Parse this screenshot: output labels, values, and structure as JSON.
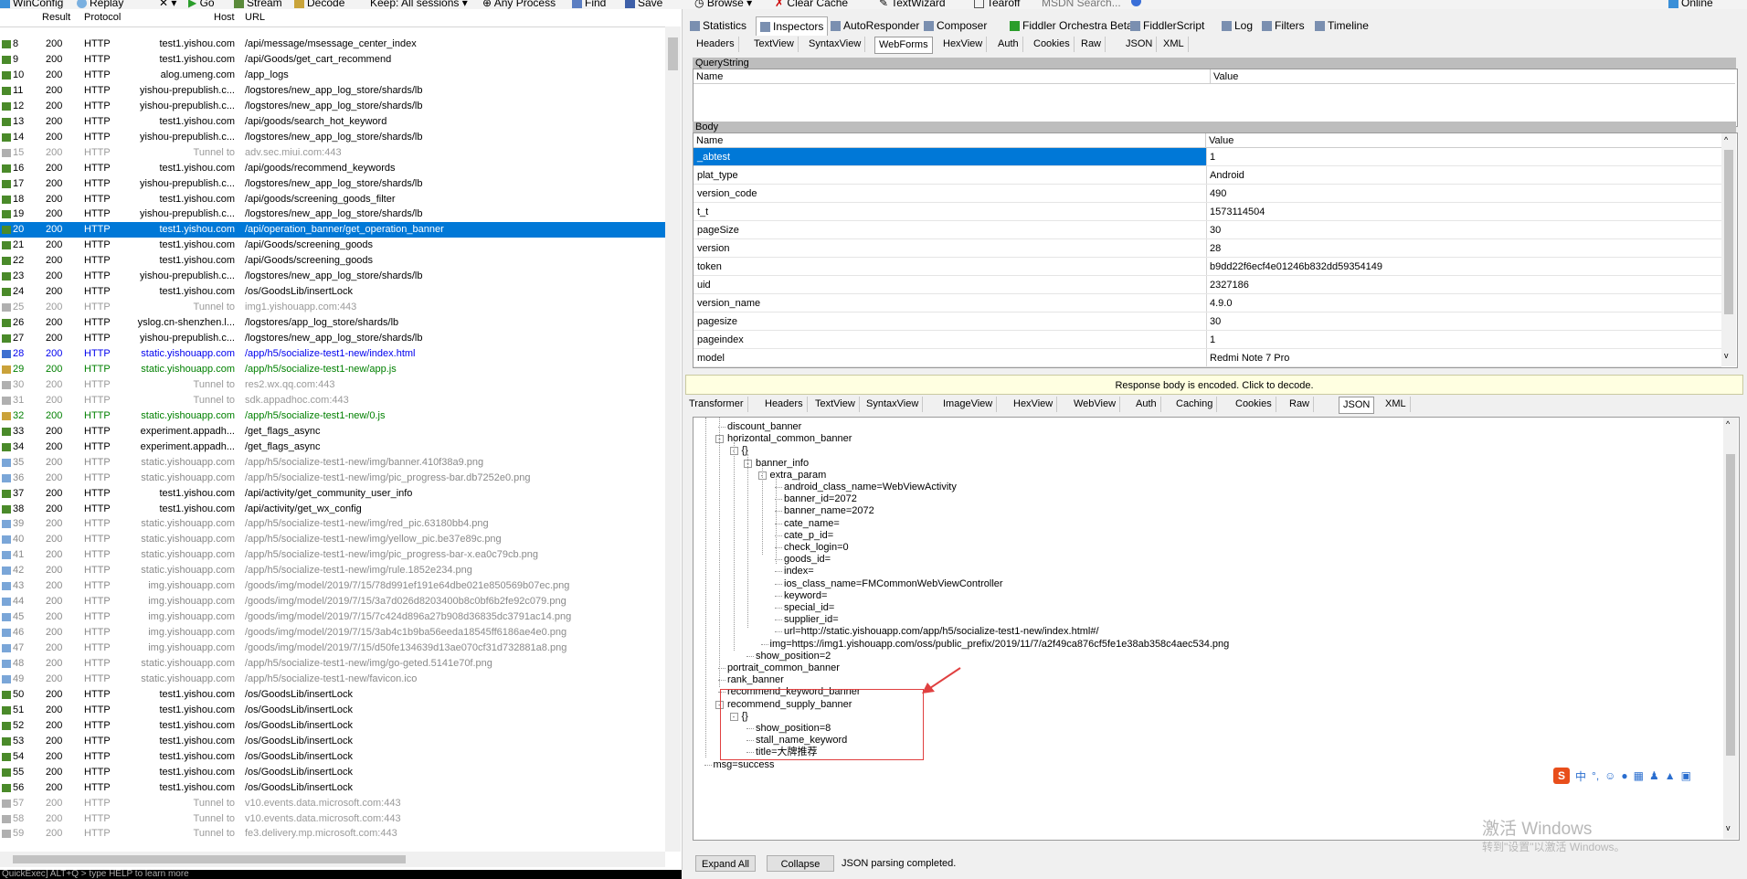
{
  "toolbar": {
    "winconfig": "WinConfig",
    "replay": "Replay",
    "remove": "✕ ▾",
    "go": "Go",
    "stream": "Stream",
    "decode": "Decode",
    "keep": "Keep: All sessions ▾",
    "process": "Any Process",
    "find": "Find",
    "save": "Save",
    "browse": "Browse ▾",
    "clear_cache": "Clear Cache",
    "textwizard": "TextWizard",
    "tearoff": "Tearoff",
    "msdn": "MSDN Search...",
    "online": "Online"
  },
  "sessions": {
    "headers": {
      "result": "Result",
      "protocol": "Protocol",
      "host": "Host",
      "url": "URL"
    },
    "rows": [
      {
        "num": "8",
        "result": "200",
        "protocol": "HTTP",
        "host": "test1.yishou.com",
        "url": "/api/message/msessage_center_index",
        "style": "normal",
        "icon": "arrow"
      },
      {
        "num": "9",
        "result": "200",
        "protocol": "HTTP",
        "host": "test1.yishou.com",
        "url": "/api/Goods/get_cart_recommend",
        "style": "normal",
        "icon": "arrow"
      },
      {
        "num": "10",
        "result": "200",
        "protocol": "HTTP",
        "host": "alog.umeng.com",
        "url": "/app_logs",
        "style": "normal",
        "icon": "arrow"
      },
      {
        "num": "11",
        "result": "200",
        "protocol": "HTTP",
        "host": "yishou-prepublish.c...",
        "url": "/logstores/new_app_log_store/shards/lb",
        "style": "normal",
        "icon": "arrow"
      },
      {
        "num": "12",
        "result": "200",
        "protocol": "HTTP",
        "host": "yishou-prepublish.c...",
        "url": "/logstores/new_app_log_store/shards/lb",
        "style": "normal",
        "icon": "arrow"
      },
      {
        "num": "13",
        "result": "200",
        "protocol": "HTTP",
        "host": "test1.yishou.com",
        "url": "/api/goods/search_hot_keyword",
        "style": "normal",
        "icon": "arrow"
      },
      {
        "num": "14",
        "result": "200",
        "protocol": "HTTP",
        "host": "yishou-prepublish.c...",
        "url": "/logstores/new_app_log_store/shards/lb",
        "style": "normal",
        "icon": "arrow"
      },
      {
        "num": "15",
        "result": "200",
        "protocol": "HTTP",
        "host": "Tunnel to",
        "url": "adv.sec.miui.com:443",
        "style": "tun",
        "icon": "lock"
      },
      {
        "num": "16",
        "result": "200",
        "protocol": "HTTP",
        "host": "test1.yishou.com",
        "url": "/api/goods/recommend_keywords",
        "style": "normal",
        "icon": "arrow"
      },
      {
        "num": "17",
        "result": "200",
        "protocol": "HTTP",
        "host": "yishou-prepublish.c...",
        "url": "/logstores/new_app_log_store/shards/lb",
        "style": "normal",
        "icon": "arrow"
      },
      {
        "num": "18",
        "result": "200",
        "protocol": "HTTP",
        "host": "test1.yishou.com",
        "url": "/api/goods/screening_goods_filter",
        "style": "normal",
        "icon": "arrow"
      },
      {
        "num": "19",
        "result": "200",
        "protocol": "HTTP",
        "host": "yishou-prepublish.c...",
        "url": "/logstores/new_app_log_store/shards/lb",
        "style": "normal",
        "icon": "arrow"
      },
      {
        "num": "20",
        "result": "200",
        "protocol": "HTTP",
        "host": "test1.yishou.com",
        "url": "/api/operation_banner/get_operation_banner",
        "style": "sel",
        "icon": "arrow"
      },
      {
        "num": "21",
        "result": "200",
        "protocol": "HTTP",
        "host": "test1.yishou.com",
        "url": "/api/Goods/screening_goods",
        "style": "normal",
        "icon": "arrow"
      },
      {
        "num": "22",
        "result": "200",
        "protocol": "HTTP",
        "host": "test1.yishou.com",
        "url": "/api/Goods/screening_goods",
        "style": "normal",
        "icon": "arrow"
      },
      {
        "num": "23",
        "result": "200",
        "protocol": "HTTP",
        "host": "yishou-prepublish.c...",
        "url": "/logstores/new_app_log_store/shards/lb",
        "style": "normal",
        "icon": "arrow"
      },
      {
        "num": "24",
        "result": "200",
        "protocol": "HTTP",
        "host": "test1.yishou.com",
        "url": "/os/GoodsLib/insertLock",
        "style": "normal",
        "icon": "arrow"
      },
      {
        "num": "25",
        "result": "200",
        "protocol": "HTTP",
        "host": "Tunnel to",
        "url": "img1.yishouapp.com:443",
        "style": "tun",
        "icon": "lock"
      },
      {
        "num": "26",
        "result": "200",
        "protocol": "HTTP",
        "host": "yslog.cn-shenzhen.l...",
        "url": "/logstores/app_log_store/shards/lb",
        "style": "normal",
        "icon": "arrow"
      },
      {
        "num": "27",
        "result": "200",
        "protocol": "HTTP",
        "host": "yishou-prepublish.c...",
        "url": "/logstores/new_app_log_store/shards/lb",
        "style": "normal",
        "icon": "arrow"
      },
      {
        "num": "28",
        "result": "200",
        "protocol": "HTTP",
        "host": "static.yishouapp.com",
        "url": "/app/h5/socialize-test1-new/index.html",
        "style": "blue",
        "icon": "html"
      },
      {
        "num": "29",
        "result": "200",
        "protocol": "HTTP",
        "host": "static.yishouapp.com",
        "url": "/app/h5/socialize-test1-new/app.js",
        "style": "green",
        "icon": "js"
      },
      {
        "num": "30",
        "result": "200",
        "protocol": "HTTP",
        "host": "Tunnel to",
        "url": "res2.wx.qq.com:443",
        "style": "tun",
        "icon": "lock"
      },
      {
        "num": "31",
        "result": "200",
        "protocol": "HTTP",
        "host": "Tunnel to",
        "url": "sdk.appadhoc.com:443",
        "style": "tun",
        "icon": "lock"
      },
      {
        "num": "32",
        "result": "200",
        "protocol": "HTTP",
        "host": "static.yishouapp.com",
        "url": "/app/h5/socialize-test1-new/0.js",
        "style": "green",
        "icon": "js"
      },
      {
        "num": "33",
        "result": "200",
        "protocol": "HTTP",
        "host": "experiment.appadh...",
        "url": "/get_flags_async",
        "style": "normal",
        "icon": "arrow"
      },
      {
        "num": "34",
        "result": "200",
        "protocol": "HTTP",
        "host": "experiment.appadh...",
        "url": "/get_flags_async",
        "style": "normal",
        "icon": "arrow"
      },
      {
        "num": "35",
        "result": "200",
        "protocol": "HTTP",
        "host": "static.yishouapp.com",
        "url": "/app/h5/socialize-test1-new/img/banner.410f38a9.png",
        "style": "gray",
        "icon": "img"
      },
      {
        "num": "36",
        "result": "200",
        "protocol": "HTTP",
        "host": "static.yishouapp.com",
        "url": "/app/h5/socialize-test1-new/img/pic_progress-bar.db7252e0.png",
        "style": "gray",
        "icon": "img"
      },
      {
        "num": "37",
        "result": "200",
        "protocol": "HTTP",
        "host": "test1.yishou.com",
        "url": "/api/activity/get_community_user_info",
        "style": "normal",
        "icon": "arrow"
      },
      {
        "num": "38",
        "result": "200",
        "protocol": "HTTP",
        "host": "test1.yishou.com",
        "url": "/api/activity/get_wx_config",
        "style": "normal",
        "icon": "arrow"
      },
      {
        "num": "39",
        "result": "200",
        "protocol": "HTTP",
        "host": "static.yishouapp.com",
        "url": "/app/h5/socialize-test1-new/img/red_pic.63180bb4.png",
        "style": "gray",
        "icon": "img"
      },
      {
        "num": "40",
        "result": "200",
        "protocol": "HTTP",
        "host": "static.yishouapp.com",
        "url": "/app/h5/socialize-test1-new/img/yellow_pic.be37e89c.png",
        "style": "gray",
        "icon": "img"
      },
      {
        "num": "41",
        "result": "200",
        "protocol": "HTTP",
        "host": "static.yishouapp.com",
        "url": "/app/h5/socialize-test1-new/img/pic_progress-bar-x.ea0c79cb.png",
        "style": "gray",
        "icon": "img"
      },
      {
        "num": "42",
        "result": "200",
        "protocol": "HTTP",
        "host": "static.yishouapp.com",
        "url": "/app/h5/socialize-test1-new/img/rule.1852e234.png",
        "style": "gray",
        "icon": "img"
      },
      {
        "num": "43",
        "result": "200",
        "protocol": "HTTP",
        "host": "img.yishouapp.com",
        "url": "/goods/img/model/2019/7/15/78d991ef191e64dbe021e850569b07ec.png",
        "style": "gray",
        "icon": "img"
      },
      {
        "num": "44",
        "result": "200",
        "protocol": "HTTP",
        "host": "img.yishouapp.com",
        "url": "/goods/img/model/2019/7/15/3a7d026d8203400b8c0bf6b2fe92c079.png",
        "style": "gray",
        "icon": "img"
      },
      {
        "num": "45",
        "result": "200",
        "protocol": "HTTP",
        "host": "img.yishouapp.com",
        "url": "/goods/img/model/2019/7/15/7c424d896a27b908d36835dc3791ac14.png",
        "style": "gray",
        "icon": "img"
      },
      {
        "num": "46",
        "result": "200",
        "protocol": "HTTP",
        "host": "img.yishouapp.com",
        "url": "/goods/img/model/2019/7/15/3ab4c1b9ba56eeda18545ff6186ae4e0.png",
        "style": "gray",
        "icon": "img"
      },
      {
        "num": "47",
        "result": "200",
        "protocol": "HTTP",
        "host": "img.yishouapp.com",
        "url": "/goods/img/model/2019/7/15/d50fe134639d13ae070cf31d732881a8.png",
        "style": "gray",
        "icon": "img"
      },
      {
        "num": "48",
        "result": "200",
        "protocol": "HTTP",
        "host": "static.yishouapp.com",
        "url": "/app/h5/socialize-test1-new/img/go-geted.5141e70f.png",
        "style": "gray",
        "icon": "img"
      },
      {
        "num": "49",
        "result": "200",
        "protocol": "HTTP",
        "host": "static.yishouapp.com",
        "url": "/app/h5/socialize-test1-new/favicon.ico",
        "style": "gray",
        "icon": "img"
      },
      {
        "num": "50",
        "result": "200",
        "protocol": "HTTP",
        "host": "test1.yishou.com",
        "url": "/os/GoodsLib/insertLock",
        "style": "normal",
        "icon": "arrow"
      },
      {
        "num": "51",
        "result": "200",
        "protocol": "HTTP",
        "host": "test1.yishou.com",
        "url": "/os/GoodsLib/insertLock",
        "style": "normal",
        "icon": "arrow"
      },
      {
        "num": "52",
        "result": "200",
        "protocol": "HTTP",
        "host": "test1.yishou.com",
        "url": "/os/GoodsLib/insertLock",
        "style": "normal",
        "icon": "arrow"
      },
      {
        "num": "53",
        "result": "200",
        "protocol": "HTTP",
        "host": "test1.yishou.com",
        "url": "/os/GoodsLib/insertLock",
        "style": "normal",
        "icon": "arrow"
      },
      {
        "num": "54",
        "result": "200",
        "protocol": "HTTP",
        "host": "test1.yishou.com",
        "url": "/os/GoodsLib/insertLock",
        "style": "normal",
        "icon": "arrow"
      },
      {
        "num": "55",
        "result": "200",
        "protocol": "HTTP",
        "host": "test1.yishou.com",
        "url": "/os/GoodsLib/insertLock",
        "style": "normal",
        "icon": "arrow"
      },
      {
        "num": "56",
        "result": "200",
        "protocol": "HTTP",
        "host": "test1.yishou.com",
        "url": "/os/GoodsLib/insertLock",
        "style": "normal",
        "icon": "arrow"
      },
      {
        "num": "57",
        "result": "200",
        "protocol": "HTTP",
        "host": "Tunnel to",
        "url": "v10.events.data.microsoft.com:443",
        "style": "tun",
        "icon": "lock"
      },
      {
        "num": "58",
        "result": "200",
        "protocol": "HTTP",
        "host": "Tunnel to",
        "url": "v10.events.data.microsoft.com:443",
        "style": "tun",
        "icon": "lock"
      },
      {
        "num": "59",
        "result": "200",
        "protocol": "HTTP",
        "host": "Tunnel to",
        "url": "fe3.delivery.mp.microsoft.com:443",
        "style": "tun",
        "icon": "lock"
      }
    ]
  },
  "quickexec": "QuickExec] ALT+Q > type HELP to learn more",
  "main_tabs": [
    "Statistics",
    "Inspectors",
    "AutoResponder",
    "Composer",
    "Fiddler Orchestra Beta",
    "FiddlerScript",
    "Log",
    "Filters",
    "Timeline"
  ],
  "request_tabs": [
    "Headers",
    "TextView",
    "SyntaxView",
    "WebForms",
    "HexView",
    "Auth",
    "Cookies",
    "Raw",
    "JSON",
    "XML"
  ],
  "querystring": {
    "title": "QueryString",
    "col_name": "Name",
    "col_value": "Value"
  },
  "body": {
    "title": "Body",
    "col_name": "Name",
    "col_value": "Value",
    "rows": [
      {
        "name": "_abtest",
        "value": "1"
      },
      {
        "name": "plat_type",
        "value": "Android"
      },
      {
        "name": "version_code",
        "value": "490"
      },
      {
        "name": "t_t",
        "value": "1573114504"
      },
      {
        "name": "pageSize",
        "value": "30"
      },
      {
        "name": "version",
        "value": "28"
      },
      {
        "name": "token",
        "value": "b9dd22f6ecf4e01246b832dd59354149"
      },
      {
        "name": "uid",
        "value": "2327186"
      },
      {
        "name": "version_name",
        "value": "4.9.0"
      },
      {
        "name": "pagesize",
        "value": "30"
      },
      {
        "name": "pageindex",
        "value": "1"
      },
      {
        "name": "model",
        "value": "Redmi Note 7 Pro"
      }
    ]
  },
  "decode_bar": "Response body is encoded. Click to decode.",
  "response_tabs": [
    "Transformer",
    "Headers",
    "TextView",
    "SyntaxView",
    "ImageView",
    "HexView",
    "WebView",
    "Auth",
    "Caching",
    "Cookies",
    "Raw",
    "JSON",
    "XML"
  ],
  "tree": [
    {
      "t": "discount_banner",
      "d": 2,
      "exp": ""
    },
    {
      "t": "horizontal_common_banner",
      "d": 2,
      "exp": "-"
    },
    {
      "t": "{}",
      "d": 3,
      "exp": "-"
    },
    {
      "t": "banner_info",
      "d": 4,
      "exp": "-"
    },
    {
      "t": "extra_param",
      "d": 5,
      "exp": "-"
    },
    {
      "t": "android_class_name=WebViewActivity",
      "d": 6,
      "exp": ""
    },
    {
      "t": "banner_id=2072",
      "d": 6,
      "exp": ""
    },
    {
      "t": "banner_name=2072",
      "d": 6,
      "exp": ""
    },
    {
      "t": "cate_name=",
      "d": 6,
      "exp": ""
    },
    {
      "t": "cate_p_id=",
      "d": 6,
      "exp": ""
    },
    {
      "t": "check_login=0",
      "d": 6,
      "exp": ""
    },
    {
      "t": "goods_id=",
      "d": 6,
      "exp": ""
    },
    {
      "t": "index=",
      "d": 6,
      "exp": ""
    },
    {
      "t": "ios_class_name=FMCommonWebViewController",
      "d": 6,
      "exp": ""
    },
    {
      "t": "keyword=",
      "d": 6,
      "exp": ""
    },
    {
      "t": "special_id=",
      "d": 6,
      "exp": ""
    },
    {
      "t": "supplier_id=",
      "d": 6,
      "exp": ""
    },
    {
      "t": "url=http://static.yishouapp.com/app/h5/socialize-test1-new/index.html#/",
      "d": 6,
      "exp": ""
    },
    {
      "t": "img=https://img1.yishouapp.com/oss/public_prefix/2019/11/7/a2f49ca876cf5fe1e38ab358c4aec534.png",
      "d": 5,
      "exp": ""
    },
    {
      "t": "show_position=2",
      "d": 4,
      "exp": ""
    },
    {
      "t": "portrait_common_banner",
      "d": 2,
      "exp": ""
    },
    {
      "t": "rank_banner",
      "d": 2,
      "exp": ""
    },
    {
      "t": "recommend_keyword_banner",
      "d": 2,
      "exp": ""
    },
    {
      "t": "recommend_supply_banner",
      "d": 2,
      "exp": "-"
    },
    {
      "t": "{}",
      "d": 3,
      "exp": "-"
    },
    {
      "t": "show_position=8",
      "d": 4,
      "exp": ""
    },
    {
      "t": "stall_name_keyword",
      "d": 4,
      "exp": ""
    },
    {
      "t": "title=大牌推荐",
      "d": 4,
      "exp": ""
    },
    {
      "t": "msg=success",
      "d": 1,
      "exp": ""
    }
  ],
  "bottom": {
    "expand_all": "Expand All",
    "collapse": "Collapse",
    "status": "JSON parsing completed."
  },
  "watermark": {
    "line1": "激活 Windows",
    "line2": "转到\"设置\"以激活 Windows。"
  },
  "ime": {
    "logo": "S",
    "mode": "中",
    "punct": "°,"
  },
  "colors": {
    "selection": "#0078d7",
    "annotation": "#e04040"
  }
}
